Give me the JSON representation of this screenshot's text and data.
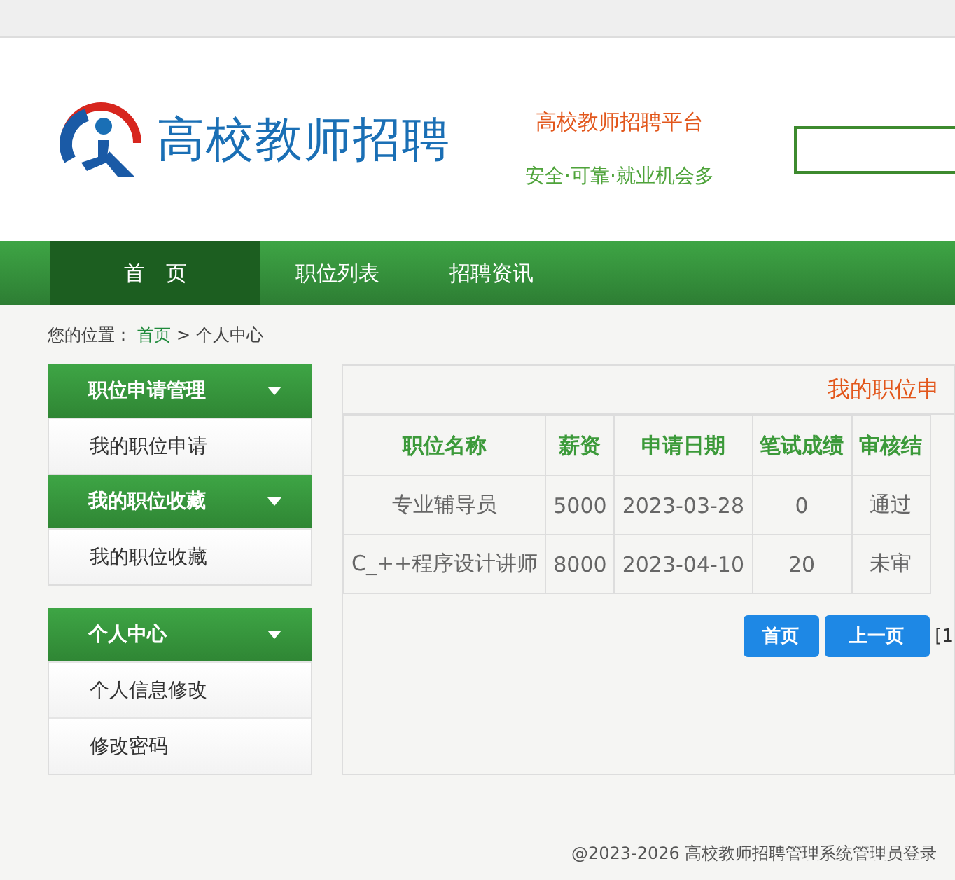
{
  "header": {
    "site_title": "高校教师招聘",
    "slogan": "高校教师招聘平台",
    "tagline": "安全·可靠·就业机会多"
  },
  "nav": [
    {
      "label": "首　页",
      "selected": true
    },
    {
      "label": "职位列表",
      "selected": false
    },
    {
      "label": "招聘资讯",
      "selected": false
    }
  ],
  "breadcrumb": {
    "prefix": "您的位置：",
    "home": "首页",
    "separator": ">",
    "current": "个人中心"
  },
  "sidebar": [
    {
      "title": "职位申请管理",
      "items": [
        "我的职位申请"
      ]
    },
    {
      "title": "我的职位收藏",
      "items": [
        "我的职位收藏"
      ]
    },
    {
      "title": "个人中心",
      "items": [
        "个人信息修改",
        "修改密码"
      ]
    }
  ],
  "panel": {
    "title": "我的职位申",
    "columns": [
      "职位名称",
      "薪资",
      "申请日期",
      "笔试成绩",
      "审核结"
    ],
    "rows": [
      [
        "专业辅导员",
        "5000",
        "2023-03-28",
        "0",
        "通过"
      ],
      [
        "C_++程序设计讲师",
        "8000",
        "2023-04-10",
        "20",
        "未审"
      ]
    ],
    "pager": {
      "buttons": [
        "首页",
        "上一页"
      ],
      "info": "[1"
    }
  },
  "footer": {
    "copyright": "@2023-2026 高校教师招聘管理系统",
    "admin_link": "管理员登录"
  }
}
